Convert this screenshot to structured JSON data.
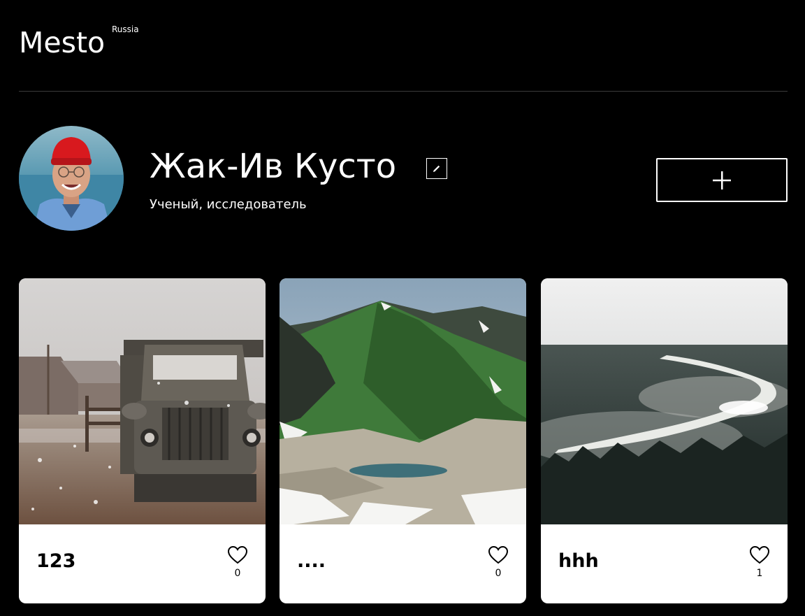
{
  "header": {
    "logo_text": "Mesto",
    "logo_region": "Russia"
  },
  "profile": {
    "name": "Жак-Ив Кусто",
    "about": "Ученый, исследователь",
    "avatar_icon": "avatar-photo",
    "edit_icon": "pencil-icon",
    "add_icon": "plus-icon"
  },
  "cards": [
    {
      "title": "123",
      "likes": "0",
      "image_subject": "old truck in snowy field"
    },
    {
      "title": "....",
      "likes": "0",
      "image_subject": "green mountains with lake"
    },
    {
      "title": "hhh",
      "likes": "1",
      "image_subject": "misty river through forest"
    }
  ],
  "colors": {
    "background": "#000000",
    "card_background": "#ffffff",
    "divider": "#545454",
    "text_on_dark": "#ffffff",
    "text_on_card": "#000000"
  }
}
